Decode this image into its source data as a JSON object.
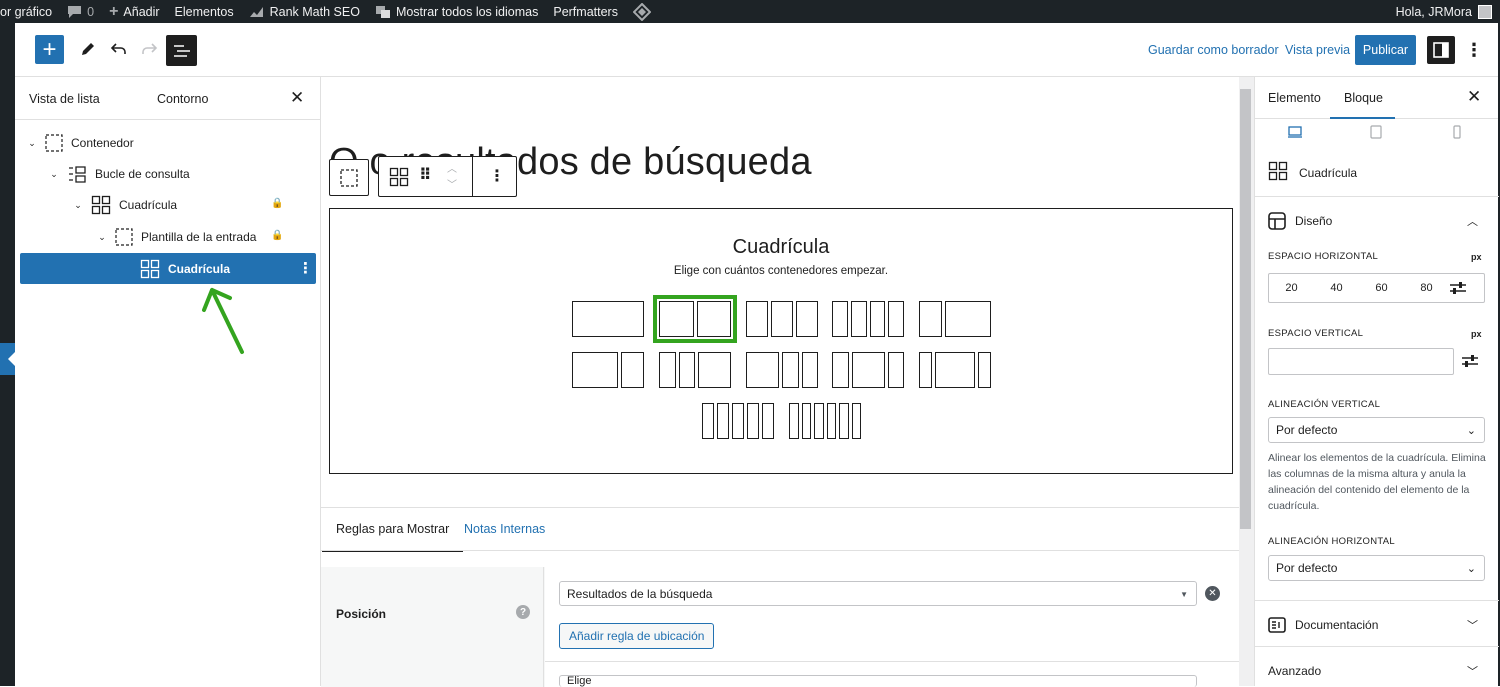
{
  "adminbar": {
    "items": [
      "or gráfico",
      "0",
      "Añadir",
      "Elementos",
      "Rank Math SEO",
      "Mostrar todos los idiomas",
      "Perfmatters"
    ],
    "greeting": "Hola, JRMora"
  },
  "toolbar": {
    "save_draft": "Guardar como borrador",
    "preview": "Vista previa",
    "publish": "Publicar"
  },
  "listview": {
    "tabs": [
      "Vista de lista",
      "Contorno"
    ],
    "items": [
      {
        "label": "Contenedor"
      },
      {
        "label": "Bucle de consulta"
      },
      {
        "label": "Cuadrícula"
      },
      {
        "label": "Plantilla de la entrada"
      },
      {
        "label": "Cuadrícula"
      }
    ]
  },
  "canvas": {
    "page_title": "Q             o resultados de búsqueda",
    "grid_title": "Cuadrícula",
    "grid_subtitle": "Elige con cuántos contenedores empezar."
  },
  "bottom": {
    "tabs": [
      "Reglas para Mostrar",
      "Notas Internas"
    ],
    "position_label": "Posición",
    "location_select": "Resultados de la búsqueda",
    "add_rule": "Añadir regla de ubicación",
    "second_select": "Elige"
  },
  "sidebar": {
    "tabs": [
      "Elemento",
      "Bloque"
    ],
    "block_name": "Cuadrícula",
    "design_title": "Diseño",
    "horizontal_label": "Espacio horizontal",
    "unit": "px",
    "horizontal_presets": [
      "20",
      "40",
      "60",
      "80"
    ],
    "vertical_label": "Espacio vertical",
    "valign_label": "Alineación vertical",
    "valign_value": "Por defecto",
    "valign_note": "Alinear los elementos de la cuadrícula. Elimina las columnas de la misma altura y anula la alineación del contenido del elemento de la cuadrícula.",
    "halign_label": "Alineación horizontal",
    "halign_value": "Por defecto",
    "documentation": "Documentación",
    "advanced": "Avanzado"
  },
  "colors": {
    "accent": "#2271b1",
    "adminbar": "#1d2327",
    "highlight": "#34a41f"
  }
}
